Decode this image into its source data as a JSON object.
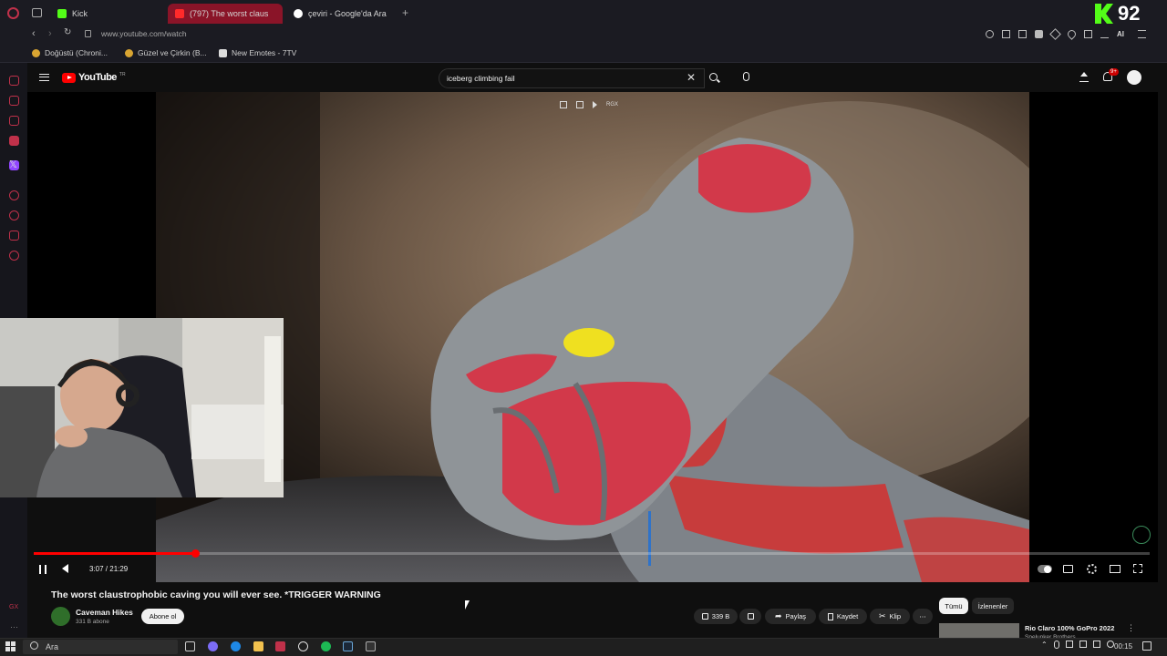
{
  "browser": {
    "tabs": [
      {
        "label": "Kick",
        "color": "#53fc18"
      },
      {
        "label": "(797) The worst claus",
        "color": "#ff0000"
      },
      {
        "label": "çeviri - Google'da Ara",
        "color": "#ffffff"
      }
    ],
    "url": "www.youtube.com/watch",
    "bookmarks": [
      "Doğüstü (Chroni...",
      "Güzel ve Çirkin (B...",
      "New Emotes - 7TV"
    ],
    "kick_counter": "92"
  },
  "youtube": {
    "logo": "YouTube",
    "logo_region": "TR",
    "search_value": "iceberg climbing fail",
    "notifications_badge": "9+",
    "video": {
      "time": "3:07 / 21:29",
      "progress_fraction": 0.1454,
      "overlay_label": "RGX",
      "title": "The worst claustrophobic caving you will ever see. *TRIGGER WARNING",
      "channel": "Caveman Hikes",
      "subscribers": "331 B abone",
      "subscribe_label": "Abone ol",
      "likes": "339 B",
      "share_label": "Paylaş",
      "save_label": "Kaydet",
      "clip_label": "Klip"
    },
    "chips": [
      "Tümü",
      "İzlenenler"
    ],
    "recommendation": {
      "title": "Rio Claro 100% GoPro 2022",
      "channel": "Spelunker Brothers"
    }
  },
  "taskbar": {
    "search_placeholder": "Ara",
    "clock": "00:15"
  },
  "colors": {
    "accent": "#ff0000",
    "kick": "#53fc18",
    "opera": "#c0314a"
  }
}
